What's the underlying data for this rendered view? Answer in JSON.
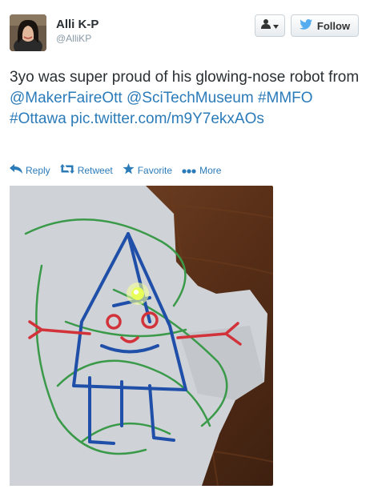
{
  "user": {
    "name": "Alli K-P",
    "handle": "@AlliKP"
  },
  "buttons": {
    "follow_label": "Follow"
  },
  "tweet": {
    "text_plain_1": "3yo was super proud of his glowing-nose robot from ",
    "mention_1": "@MakerFaireOtt",
    "mention_2": "@SciTechMuseum",
    "hashtag_1": "#MMFO",
    "hashtag_2": "#Ottawa",
    "link": "pic.twitter.com/m9Y7ekxAOs"
  },
  "actions": {
    "reply": "Reply",
    "retweet": "Retweet",
    "favorite": "Favorite",
    "more": "More"
  },
  "colors": {
    "link": "#2b7bb9",
    "text": "#292f33",
    "muted": "#8899a6"
  },
  "icons": [
    "user-icon",
    "chevron-down-icon",
    "twitter-bird-icon",
    "reply-icon",
    "retweet-icon",
    "star-icon",
    "more-dots-icon"
  ]
}
